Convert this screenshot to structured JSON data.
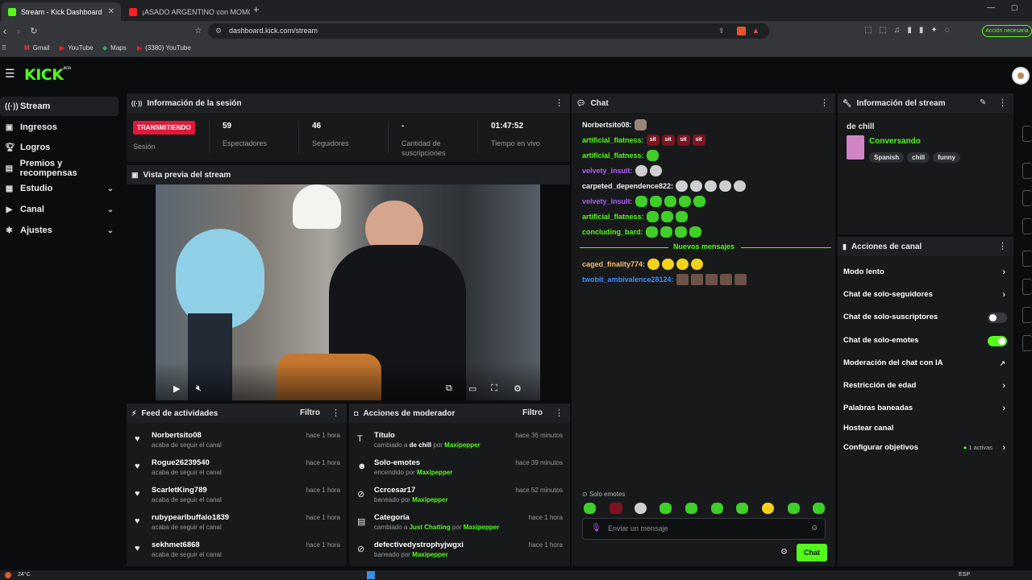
{
  "browser": {
    "tabs": [
      {
        "title": "Stream - Kick Dashboard",
        "active": true
      },
      {
        "title": "¡ASADO ARGENTINO con MOMO",
        "active": false
      }
    ],
    "url": "dashboard.kick.com/stream",
    "action_required": "Acción necesaria",
    "bookmarks": [
      "Gmail",
      "YouTube",
      "Maps",
      "(3380) YouTube"
    ]
  },
  "header": {
    "logo": "KICK",
    "logo_sup": "BETA"
  },
  "sidebar": {
    "items": [
      {
        "label": "Stream",
        "icon": "broadcast-icon",
        "active": true
      },
      {
        "label": "Ingresos",
        "icon": "money-icon"
      },
      {
        "label": "Logros",
        "icon": "trophy-icon"
      },
      {
        "label": "Premios y recompensas",
        "icon": "gift-icon"
      },
      {
        "label": "Estudio",
        "icon": "studio-icon",
        "expandable": true
      },
      {
        "label": "Canal",
        "icon": "channel-icon",
        "expandable": true
      },
      {
        "label": "Ajustes",
        "icon": "settings-icon",
        "expandable": true
      }
    ]
  },
  "session": {
    "title": "Información de la sesión",
    "status": "TRANSMITIENDO",
    "status_label": "Sesión",
    "viewers": "59",
    "viewers_label": "Espectadores",
    "followers": "46",
    "followers_label": "Seguidores",
    "subs": "-",
    "subs_label": "Cantidad de suscripciones",
    "uptime": "01:47:52",
    "uptime_label": "Tiempo en vivo"
  },
  "preview": {
    "title": "Vista previa del stream"
  },
  "activity": {
    "title": "Feed de actividades",
    "filter": "Filtro",
    "items": [
      {
        "name": "Norbertsito08",
        "sub": "acaba de seguir el canal",
        "time": "hace 1 hora"
      },
      {
        "name": "Rogue26239540",
        "sub": "acaba de seguir el canal",
        "time": "hace 1 hora"
      },
      {
        "name": "ScarletKing789",
        "sub": "acaba de seguir el canal",
        "time": "hace 1 hora"
      },
      {
        "name": "rubypearlbuffalo1839",
        "sub": "acaba de seguir el canal",
        "time": "hace 1 hora"
      },
      {
        "name": "sekhmet6868",
        "sub": "acaba de seguir el canal",
        "time": "hace 1 hora"
      }
    ]
  },
  "moderator": {
    "title": "Acciones de moderador",
    "filter": "Filtro",
    "items": [
      {
        "name": "Título",
        "pre": "cambiado a ",
        "value": "de chill",
        "mid": " por ",
        "user": "Maxipepper",
        "time": "hace 36 minutos",
        "icon": "text-icon"
      },
      {
        "name": "Solo-emotes",
        "pre": "encendido por ",
        "value": "",
        "mid": "",
        "user": "Maxipepper",
        "time": "hace 39 minutos",
        "icon": "emote-icon"
      },
      {
        "name": "Ccrcesar17",
        "pre": "baneado por ",
        "value": "",
        "mid": "",
        "user": "Maxipepper",
        "time": "hace 52 minutos",
        "icon": "ban-icon"
      },
      {
        "name": "Categoría",
        "pre": "cambiado a ",
        "value": "Just Chatting",
        "mid": " por ",
        "user": "Maxipepper",
        "time": "hace 1 hora",
        "icon": "category-icon"
      },
      {
        "name": "defectivedystrophyjwgxi",
        "pre": "baneado por ",
        "value": "",
        "mid": "",
        "user": "Maxipepper",
        "time": "hace 1 hora",
        "icon": "ban-icon"
      }
    ]
  },
  "chat": {
    "title": "Chat",
    "new_messages": "Nuevos mensajes",
    "emote_only": "Solo emotes",
    "placeholder": "Enviar un mensaje",
    "send": "Chat",
    "messages": [
      {
        "user": "Norbertsito08:",
        "color": "#f0f0f0",
        "emotes": [
          "cat"
        ]
      },
      {
        "user": "artificial_flatness:",
        "color": "#53fc18",
        "emotes": [
          "sit",
          "sit",
          "sit",
          "sit"
        ]
      },
      {
        "user": "artificial_flatness:",
        "color": "#53fc18",
        "emotes": [
          "green"
        ]
      },
      {
        "user": "velvety_insult:",
        "color": "#b45cff",
        "emotes": [
          "gray",
          "gray"
        ]
      },
      {
        "user": "carpeted_dependence822:",
        "color": "#f0f0f0",
        "emotes": [
          "gray",
          "gray",
          "gray",
          "gray",
          "gray"
        ]
      },
      {
        "user": "velvety_insult:",
        "color": "#b45cff",
        "emotes": [
          "green",
          "green",
          "green",
          "green",
          "green"
        ]
      },
      {
        "user": "artificial_flatness:",
        "color": "#53fc18",
        "emotes": [
          "green",
          "green",
          "green"
        ]
      },
      {
        "user": "concluding_bard:",
        "color": "#53fc18",
        "emotes": [
          "green",
          "green",
          "green",
          "green"
        ]
      },
      {
        "user": "caged_finality774:",
        "color": "#f5c16c",
        "emotes": [
          "yellow",
          "yellow",
          "yellow",
          "yellow"
        ]
      },
      {
        "user": "twobit_ambivalence28124:",
        "color": "#3f8cff",
        "emotes": [
          "face",
          "face",
          "face",
          "face",
          "face"
        ]
      }
    ]
  },
  "stream_info": {
    "title": "Información del stream",
    "stream_title": "de chill",
    "category": "Conversando",
    "tags": [
      "Spanish",
      "chill",
      "funny"
    ]
  },
  "channel_actions": {
    "title": "Acciones de canal",
    "items": [
      {
        "label": "Modo lento",
        "control": "chevron"
      },
      {
        "label": "Chat de solo-seguidores",
        "control": "chevron"
      },
      {
        "label": "Chat de solo-suscriptores",
        "control": "toggle-off"
      },
      {
        "label": "Chat de solo-emotes",
        "control": "toggle-on"
      },
      {
        "label": "Moderación del chat con IA",
        "control": "external"
      },
      {
        "label": "Restricción de edad",
        "control": "chevron"
      },
      {
        "label": "Palabras baneadas",
        "control": "chevron"
      },
      {
        "label": "Hostear canal",
        "control": "none"
      },
      {
        "label": "Configurar objetivos",
        "control": "chevron",
        "extra": "1 activas"
      }
    ]
  },
  "taskbar": {
    "temp": "24°C",
    "lang": "ESP"
  },
  "colors": {
    "accent": "#53fc18",
    "live": "#e0193a",
    "panel": "#18191b"
  }
}
